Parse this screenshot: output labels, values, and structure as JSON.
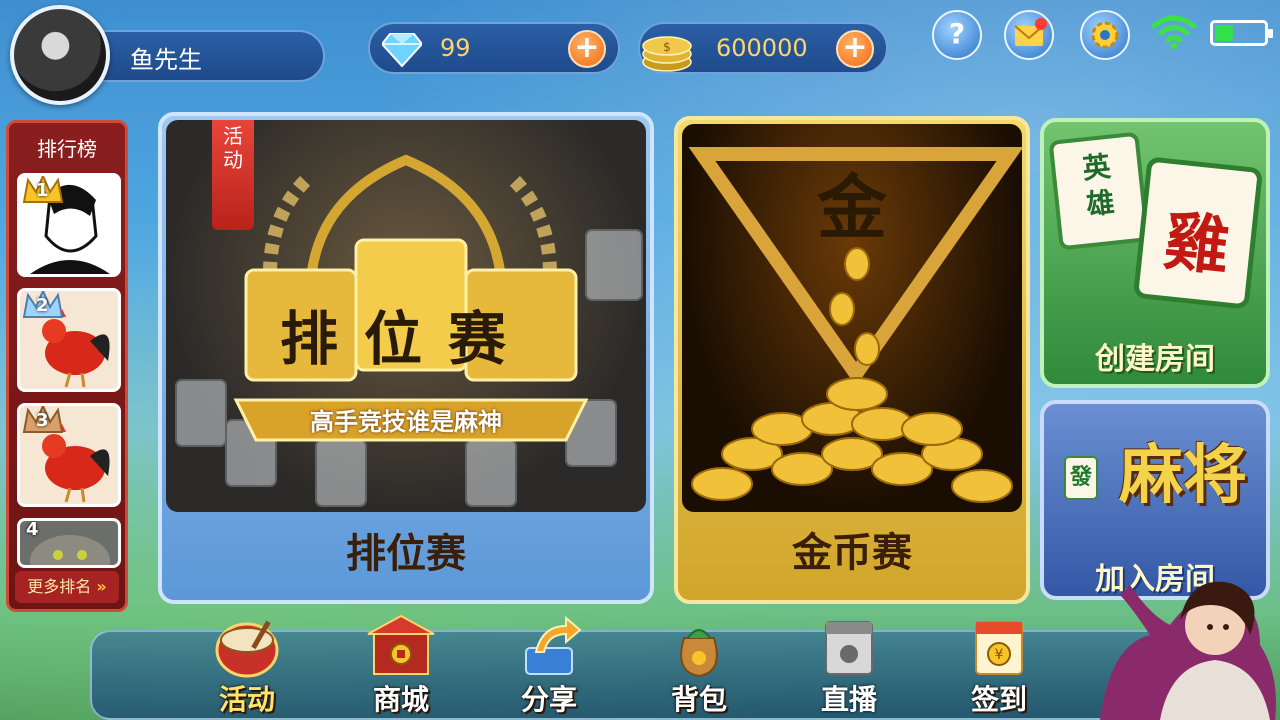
{
  "user": {
    "name": "鱼先生"
  },
  "resources": {
    "diamonds": "99",
    "coins": "600000"
  },
  "top_icons": [
    "help-icon",
    "mail-icon",
    "settings-icon",
    "wifi-icon",
    "battery-icon"
  ],
  "ranking": {
    "title": "排行榜",
    "ranks": [
      "1",
      "2",
      "3",
      "4"
    ],
    "more_label": "更多排名"
  },
  "cards": {
    "ranked": {
      "label": "排位赛",
      "badge": "活动",
      "banner_title": "排位赛",
      "banner_subtitle": "高手竞技谁是麻神"
    },
    "gold": {
      "label": "金币赛",
      "emblem": "金"
    },
    "create_room": {
      "label": "创建房间",
      "tile_a": "英雄",
      "tile_b": "雞"
    },
    "join_room": {
      "label": "加入房间",
      "logo": "麻将",
      "small_tile": "發"
    }
  },
  "nav": [
    {
      "label": "活动"
    },
    {
      "label": "商城"
    },
    {
      "label": "分享"
    },
    {
      "label": "背包"
    },
    {
      "label": "直播"
    },
    {
      "label": "签到"
    }
  ],
  "colors": {
    "accent_orange": "#f06a12",
    "gold_text": "#ffd56a",
    "panel_red": "#8a1e1e"
  }
}
